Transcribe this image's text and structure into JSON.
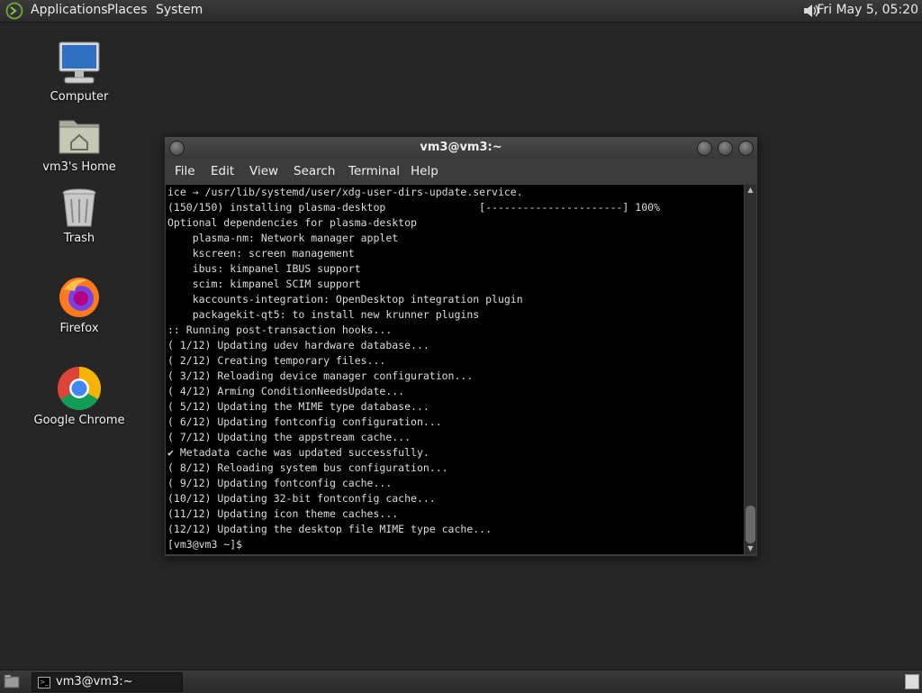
{
  "top_panel": {
    "menus": [
      "Applications",
      "Places",
      "System"
    ],
    "clock": "Fri May  5, 05:20",
    "icons": {
      "logo": "distro-logo-icon",
      "volume": "volume-icon"
    }
  },
  "desktop": {
    "icons": [
      {
        "label": "Computer",
        "icon": "computer-icon"
      },
      {
        "label": "vm3's Home",
        "icon": "home-folder-icon"
      },
      {
        "label": "Trash",
        "icon": "trash-icon"
      },
      {
        "label": "Firefox",
        "icon": "firefox-icon"
      },
      {
        "label": "Google Chrome",
        "icon": "chrome-icon"
      }
    ]
  },
  "terminal": {
    "title": "vm3@vm3:~",
    "menu": [
      "File",
      "Edit",
      "View",
      "Search",
      "Terminal",
      "Help"
    ],
    "lines": [
      "ice → /usr/lib/systemd/user/xdg-user-dirs-update.service.",
      "(150/150) installing plasma-desktop               [----------------------] 100%",
      "Optional dependencies for plasma-desktop",
      "    plasma-nm: Network manager applet",
      "    kscreen: screen management",
      "    ibus: kimpanel IBUS support",
      "    scim: kimpanel SCIM support",
      "    kaccounts-integration: OpenDesktop integration plugin",
      "    packagekit-qt5: to install new krunner plugins",
      ":: Running post-transaction hooks...",
      "( 1/12) Updating udev hardware database...",
      "( 2/12) Creating temporary files...",
      "( 3/12) Reloading device manager configuration...",
      "( 4/12) Arming ConditionNeedsUpdate...",
      "( 5/12) Updating the MIME type database...",
      "( 6/12) Updating fontconfig configuration...",
      "( 7/12) Updating the appstream cache...",
      "✔ Metadata cache was updated successfully.",
      "( 8/12) Reloading system bus configuration...",
      "( 9/12) Updating fontconfig cache...",
      "(10/12) Updating 32-bit fontconfig cache...",
      "(11/12) Updating icon theme caches...",
      "(12/12) Updating the desktop file MIME type cache...",
      "[vm3@vm3 ~]$ "
    ]
  },
  "taskbar": {
    "tasks": [
      {
        "label": "vm3@vm3:~",
        "icon": "terminal-icon"
      }
    ],
    "icons": {
      "show_desktop": "show-desktop-icon",
      "workspace": "workspace-switcher-icon"
    }
  }
}
